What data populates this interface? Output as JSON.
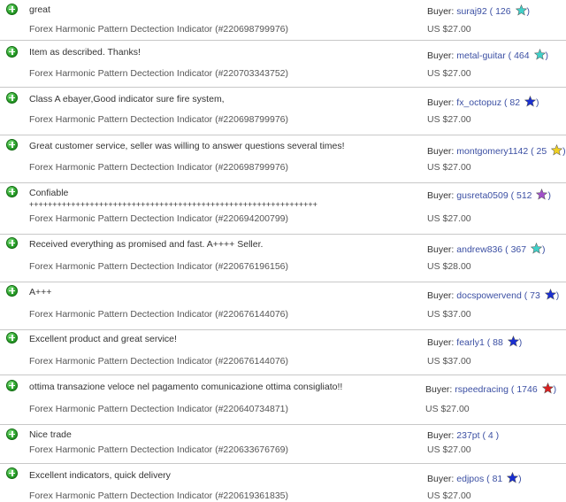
{
  "labels": {
    "buyer": "Buyer:"
  },
  "colors": {
    "positive_icon": "#2fa52f",
    "star_turquoise": "#40d0c8",
    "star_blue": "#1a2fd0",
    "star_yellow": "#f0d020",
    "star_purple": "#a050c8",
    "star_red": "#d82020"
  },
  "feedback": [
    {
      "comment": "great",
      "item": "Forex Harmonic Pattern Dectection Indicator (#220698799976)",
      "buyer": "suraj92",
      "score": "( 126",
      "close": ")",
      "star": "turquoise-star-icon",
      "star_color": "#40d0c8",
      "price": "US $27.00"
    },
    {
      "comment": "Item as described. Thanks!",
      "item": "Forex Harmonic Pattern Dectection Indicator (#220703343752)",
      "buyer": "metal-guitar",
      "score": "( 464",
      "close": ")",
      "star": "turquoise-star-icon",
      "star_color": "#40d0c8",
      "price": "US $27.00"
    },
    {
      "comment": "Class A ebayer,Good indicator sure fire system,",
      "item": "Forex Harmonic Pattern Dectection Indicator (#220698799976)",
      "buyer": "fx_octopuz",
      "score": "( 82",
      "close": ")",
      "star": "blue-star-icon",
      "star_color": "#1a2fd0",
      "price": "US $27.00"
    },
    {
      "comment": "Great customer service, seller was willing to answer questions several times!",
      "item": "Forex Harmonic Pattern Dectection Indicator (#220698799976)",
      "buyer": "montgomery1142",
      "score": "( 25",
      "close": ")",
      "star": "yellow-star-icon",
      "star_color": "#f0d020",
      "price": "US $27.00"
    },
    {
      "comment": "Confiable",
      "comment2": "++++++++++++++++++++++++++++++++++++++++++++++++++++++++++++++",
      "item": "Forex Harmonic Pattern Dectection Indicator (#220694200799)",
      "buyer": "gusreta0509",
      "score": "( 512",
      "close": ")",
      "star": "purple-star-icon",
      "star_color": "#a050c8",
      "price": "US $27.00"
    },
    {
      "comment": "Received everything as promised and fast. A++++ Seller.",
      "item": "Forex Harmonic Pattern Dectection Indicator (#220676196156)",
      "buyer": "andrew836",
      "score": "( 367",
      "close": ")",
      "star": "turquoise-star-icon",
      "star_color": "#40d0c8",
      "price": "US $28.00"
    },
    {
      "comment": "A+++",
      "item": "Forex Harmonic Pattern Dectection Indicator (#220676144076)",
      "buyer": "docspowervend",
      "score": "( 73",
      "close": ")",
      "star": "blue-star-icon",
      "star_color": "#1a2fd0",
      "price": "US $37.00"
    },
    {
      "comment": "Excellent product and great service!",
      "item": "Forex Harmonic Pattern Dectection Indicator (#220676144076)",
      "buyer": "fearly1",
      "score": "( 88",
      "close": ")",
      "star": "blue-star-icon",
      "star_color": "#1a2fd0",
      "price": "US $37.00"
    },
    {
      "comment": "ottima transazione veloce nel pagamento comunicazione ottima consigliato!!",
      "item": "Forex Harmonic Pattern Dectection Indicator (#220640734871)",
      "buyer": "rspeedracing",
      "score": "( 1746",
      "close": ")",
      "star": "red-star-icon",
      "star_color": "#d82020",
      "price": "US $27.00"
    },
    {
      "comment": "Nice trade",
      "item": "Forex Harmonic Pattern Dectection Indicator (#220633676769)",
      "buyer": "237pt",
      "score": "( 4",
      "close": ")",
      "star": "",
      "star_color": "",
      "price": "US $27.00"
    },
    {
      "comment": "Excellent indicators, quick delivery",
      "item": "Forex Harmonic Pattern Dectection Indicator (#220619361835)",
      "buyer": "edjpos",
      "score": "( 81",
      "close": ")",
      "star": "blue-star-icon",
      "star_color": "#1a2fd0",
      "price": "US $27.00"
    }
  ]
}
